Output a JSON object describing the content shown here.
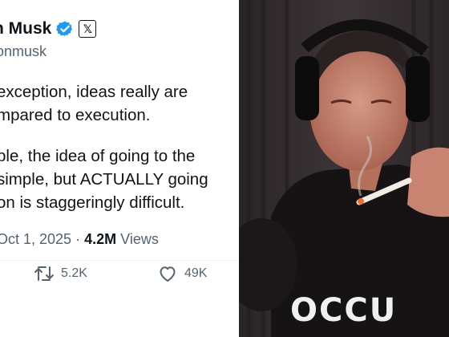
{
  "tweet": {
    "display_name": "n Musk",
    "handle": "onmusk",
    "text_lines_1": [
      "exception, ideas really are",
      "mpared to execution."
    ],
    "text_lines_2": [
      "ple, the idea of going to the",
      "simple, but ACTUALLY going",
      "on is staggeringly difficult."
    ],
    "date": "Oct 1, 2025",
    "separator": "·",
    "views_count": "4.2M",
    "views_label": "Views",
    "retweets": "5.2K",
    "likes": "49K"
  },
  "photo": {
    "shirt_text": "OCCU"
  },
  "colors": {
    "verified": "#1d9bf0",
    "text": "#0f1419",
    "muted": "#536471"
  },
  "icons": [
    "verified-badge-icon",
    "x-logo-icon",
    "retweet-icon",
    "heart-icon"
  ]
}
